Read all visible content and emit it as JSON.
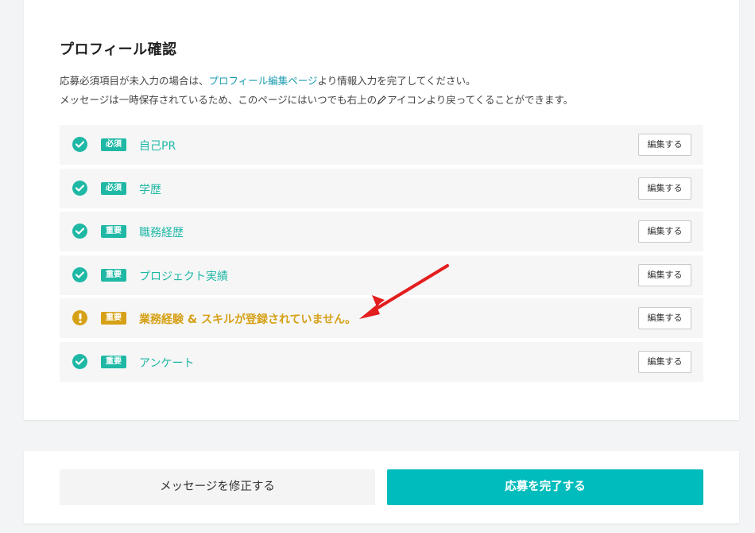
{
  "profile_check": {
    "title": "プロフィール確認",
    "description_line1_before": "応募必須項目が未入力の場合は、",
    "description_link": "プロフィール編集ページ",
    "description_line1_after": "より情報入力を完了してください。",
    "description_line2_before": "メッセージは一時保存されているため、このページにはいつでも右上の",
    "description_line2_icon": "pen-icon",
    "description_line2_after": "アイコンより戻ってくることができます。",
    "edit_label": "編集する",
    "rows": [
      {
        "badge": "必須",
        "label": "自己PR",
        "status": "ok",
        "status_icon": "check-circle-icon"
      },
      {
        "badge": "必須",
        "label": "学歴",
        "status": "ok",
        "status_icon": "check-circle-icon"
      },
      {
        "badge": "重要",
        "label": "職務経歴",
        "status": "ok",
        "status_icon": "check-circle-icon"
      },
      {
        "badge": "重要",
        "label": "プロジェクト実績",
        "status": "ok",
        "status_icon": "check-circle-icon"
      },
      {
        "badge": "重要",
        "label": "業務経験 & スキルが登録されていません。",
        "status": "warn",
        "status_icon": "exclamation-circle-icon"
      },
      {
        "badge": "重要",
        "label": "アンケート",
        "status": "ok",
        "status_icon": "check-circle-icon"
      }
    ]
  },
  "actions": {
    "edit_message_label": "メッセージを修正する",
    "complete_label": "応募を完了する"
  },
  "colors": {
    "ok": "#1fb8a5",
    "warn": "#d6a116",
    "primary": "#00bcbc",
    "link": "#1a9bb0",
    "annotation_arrow": "#e31e1e"
  }
}
